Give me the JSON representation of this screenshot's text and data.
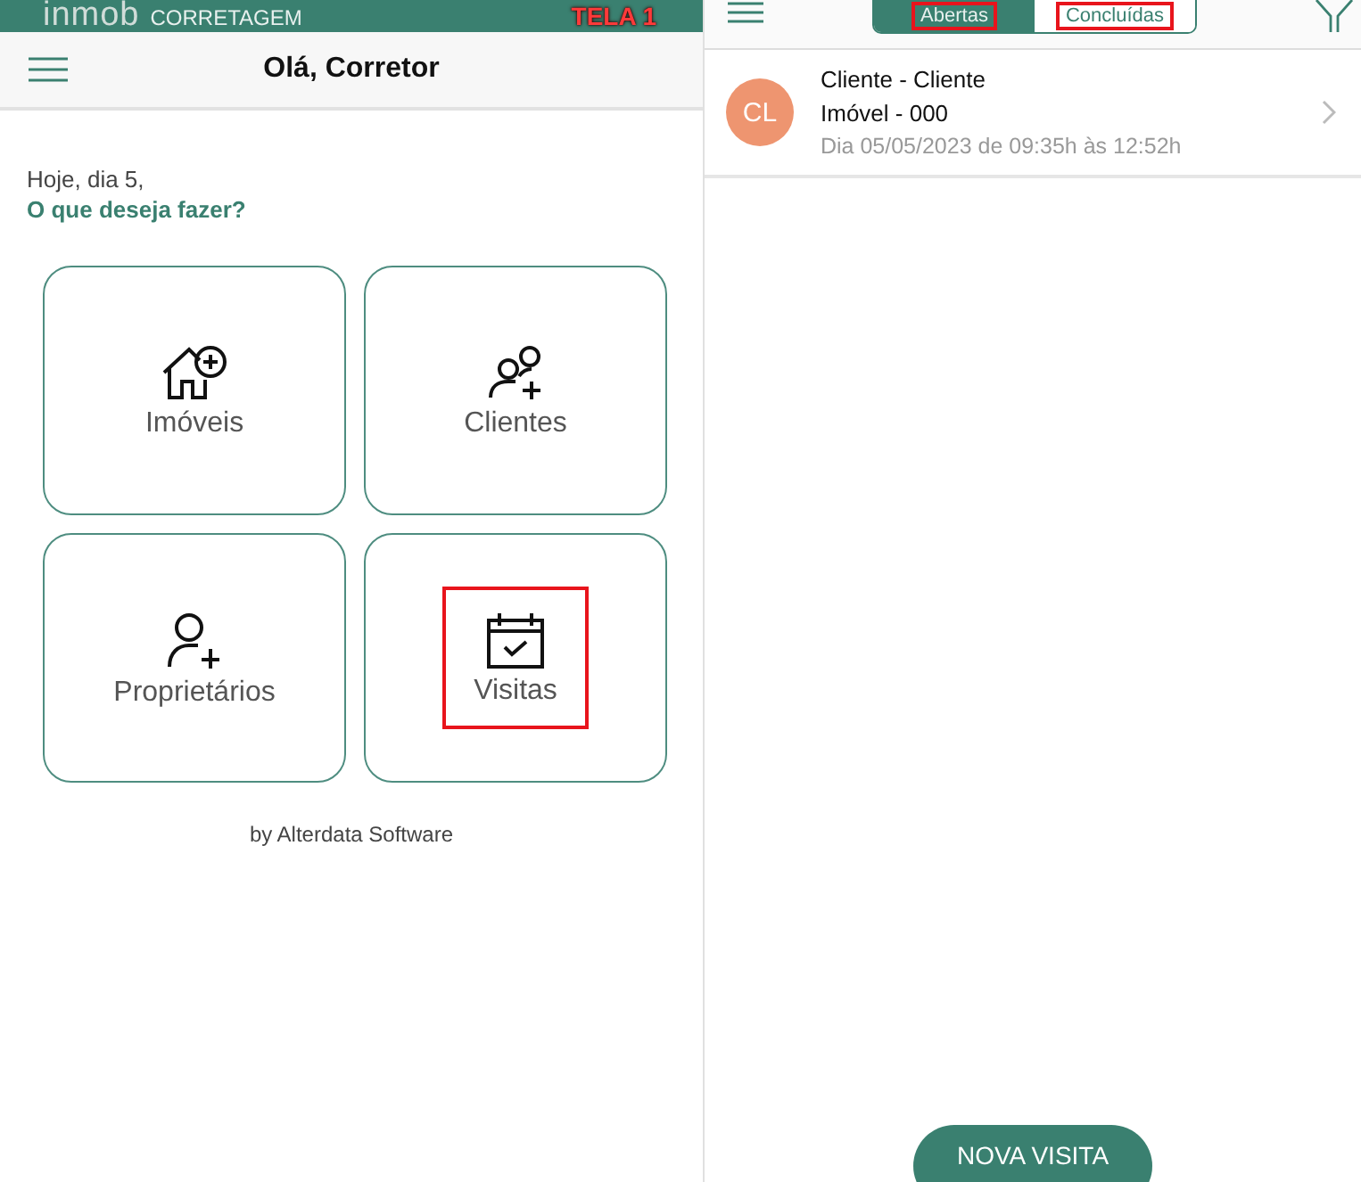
{
  "home": {
    "brand": {
      "logo": "inmob",
      "product": "CORRETAGEM"
    },
    "screen_label": "TELA 1",
    "title": "Olá, Corretor",
    "greeting": "Hoje, dia 5,",
    "prompt": "O que deseja fazer?",
    "tiles": [
      {
        "label": "Imóveis",
        "highlighted": false
      },
      {
        "label": "Clientes",
        "highlighted": false
      },
      {
        "label": "Proprietários",
        "highlighted": false
      },
      {
        "label": "Visitas",
        "highlighted": true
      }
    ],
    "footer": "by Alterdata Software"
  },
  "visits": {
    "tabs": [
      {
        "label": "Abertas",
        "selected": true,
        "highlighted": true
      },
      {
        "label": "Concluídas",
        "selected": false,
        "highlighted": true
      }
    ],
    "items": [
      {
        "initials": "CL",
        "color": "#ee9570",
        "title": "Cliente - Cliente",
        "property": "Imóvel - 000",
        "schedule": "Dia 05/05/2023 de 09:35h às 12:52h"
      }
    ],
    "new_button": "NOVA VISITA"
  }
}
